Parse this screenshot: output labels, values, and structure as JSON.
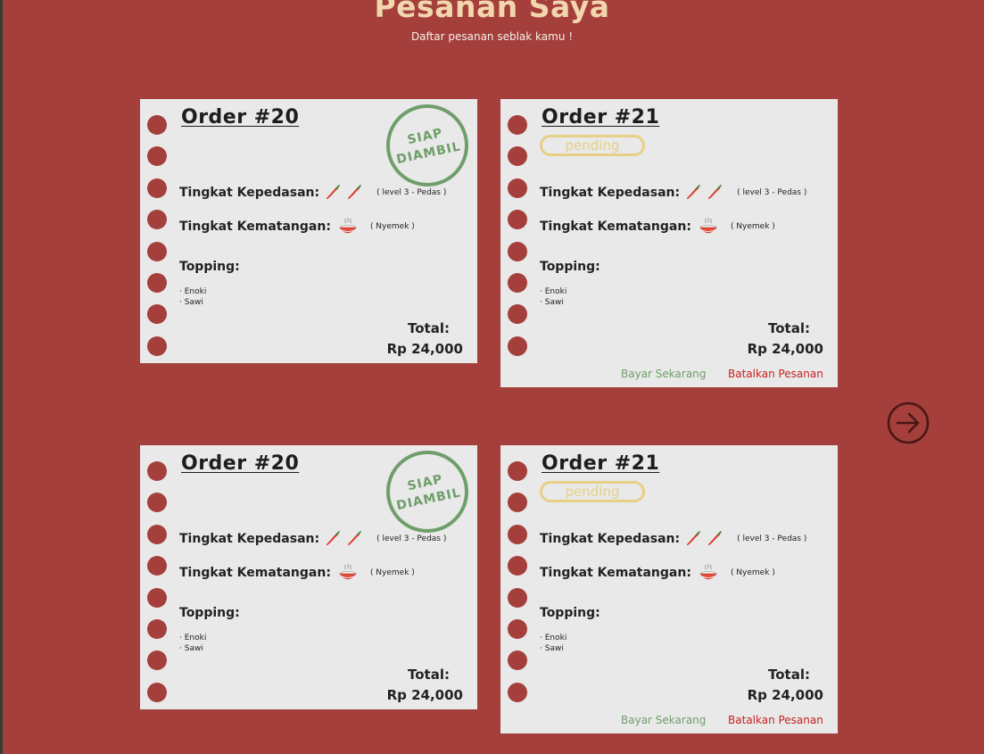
{
  "header": {
    "title": "Pesanan Saya",
    "subtitle": "Daftar pesanan seblak kamu !"
  },
  "labels": {
    "spice": "Tingkat Kepedasan:",
    "doneness": "Tingkat Kematangan:",
    "topping": "Topping:",
    "total": "Total:",
    "pay": "Bayar Sekarang",
    "cancel": "Batalkan Pesanan"
  },
  "orders": [
    {
      "title": "Order #20",
      "status": "SIAP DIAMBIL",
      "stamp_line1": "SIAP",
      "stamp_line2": "DIAMBIL",
      "spice_note": "( level 3 - Pedas )",
      "doneness_note": "( Nyemek )",
      "toppings": [
        "Enoki",
        "Sawi"
      ],
      "total": "Rp 24,000"
    },
    {
      "title": "Order #21",
      "status": "pending",
      "spice_note": "( level 3 - Pedas )",
      "doneness_note": "( Nyemek )",
      "toppings": [
        "Enoki",
        "Sawi"
      ],
      "total": "Rp 24,000"
    },
    {
      "title": "Order #20",
      "status": "SIAP DIAMBIL",
      "stamp_line1": "SIAP",
      "stamp_line2": "DIAMBIL",
      "spice_note": "( level 3 - Pedas )",
      "doneness_note": "( Nyemek )",
      "toppings": [
        "Enoki",
        "Sawi"
      ],
      "total": "Rp 24,000"
    },
    {
      "title": "Order #21",
      "status": "pending",
      "spice_note": "( level 3 - Pedas )",
      "doneness_note": "( Nyemek )",
      "toppings": [
        "Enoki",
        "Sawi"
      ],
      "total": "Rp 24,000"
    }
  ],
  "icons": {
    "spice": "chili-icon",
    "doneness": "bowl-icon",
    "next": "arrow-right-circle-icon"
  },
  "colors": {
    "background": "#a43f3b",
    "card": "#e9e9e9",
    "ready_stamp": "#6f9e6a",
    "pending": "#e7cf86",
    "pay": "#6f9e6a",
    "cancel": "#c81e1e",
    "title": "#f2d6ae"
  }
}
